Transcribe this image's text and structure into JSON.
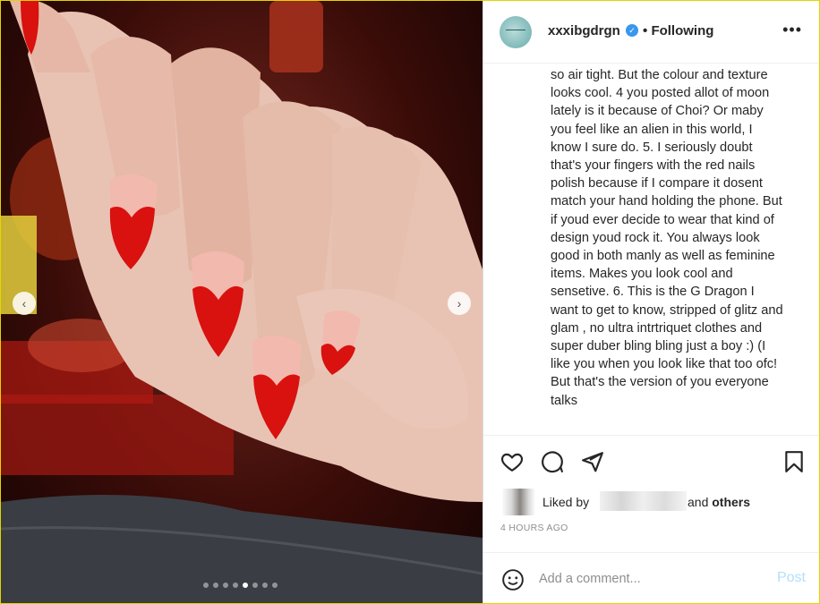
{
  "post": {
    "username": "xxxibgdrgn",
    "follow_status": "Following",
    "separator": "•",
    "more_icon": "more-dots-icon",
    "comment_text": "so air tight. But the colour and texture looks cool. 4 you posted allot of moon lately is it because of Choi? Or maby you feel like an alien in this world, I know I sure do. 5. I seriously doubt that's your fingers with the red nails polish because if I compare it dosent match your hand holding the phone. But if youd ever decide to wear that kind of design youd rock it. You always look good in both manly as well as feminine items. Makes you look cool and sensetive. 6. This is the G Dragon I want to get to know, stripped of glitz and glam , no ultra intrtriquet clothes and super duber bling bling just a boy :) (I like you when you look like that too ofc! But that's the version of you everyone talks"
  },
  "carousel": {
    "prev_label": "‹",
    "next_label": "›",
    "dot_count": 8,
    "active_index": 4
  },
  "actions": {
    "like_icon": "heart-icon",
    "comment_icon": "comment-icon",
    "share_icon": "paper-plane-icon",
    "save_icon": "bookmark-icon"
  },
  "likes": {
    "liked_by": "Liked by",
    "and_text": "and",
    "others": "others"
  },
  "timestamp": "4 HOURS AGO",
  "add_comment": {
    "placeholder": "Add a comment...",
    "post_label": "Post"
  },
  "colors": {
    "accent": "#3897f0",
    "post_disabled": "#b2dffc",
    "nail_red": "#d9110f"
  }
}
